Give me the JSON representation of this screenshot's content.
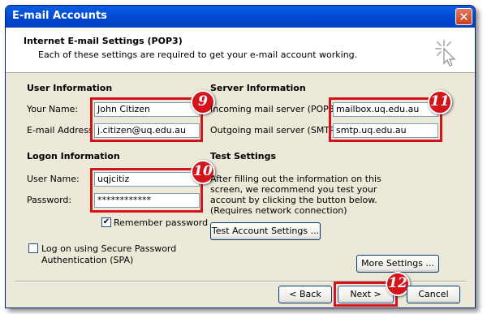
{
  "window": {
    "title": "E-mail Accounts",
    "close_glyph": "✕"
  },
  "header": {
    "title": "Internet E-mail Settings (POP3)",
    "subtitle": "Each of these settings are required to get your e-mail account working."
  },
  "user_info": {
    "heading": "User Information",
    "name_label": "Your Name:",
    "name_value": "John Citizen",
    "email_label": "E-mail Address:",
    "email_value": "j.citizen@uq.edu.au"
  },
  "server_info": {
    "heading": "Server Information",
    "incoming_label": "Incoming mail server (POP3):",
    "incoming_value": "mailbox.uq.edu.au",
    "outgoing_label": "Outgoing mail server (SMTP):",
    "outgoing_value": "smtp.uq.edu.au"
  },
  "logon_info": {
    "heading": "Logon Information",
    "username_label": "User Name:",
    "username_value": "uqjcitiz",
    "password_label": "Password:",
    "password_value": "************",
    "remember_label": "Remember password",
    "remember_checked": true,
    "spa_label_line1": "Log on using Secure Password",
    "spa_label_line2": "Authentication (SPA)",
    "spa_checked": false
  },
  "test_settings": {
    "heading": "Test Settings",
    "description": "After filling out the information on this screen, we recommend you test your account by clicking the button below. (Requires network connection)",
    "test_button": "Test Account Settings ..."
  },
  "buttons": {
    "more_settings": "More Settings ...",
    "back": "< Back",
    "next": "Next >",
    "cancel": "Cancel"
  },
  "annotations": {
    "badge_9": "9",
    "badge_10": "10",
    "badge_11": "11",
    "badge_12": "12"
  },
  "colors": {
    "titlebar": "#0047cf",
    "highlight": "#d4141a",
    "dialog_bg": "#ece9d8"
  },
  "icons": {
    "wizard": "wizard-sparkle-cursor-icon",
    "check": "✔"
  }
}
